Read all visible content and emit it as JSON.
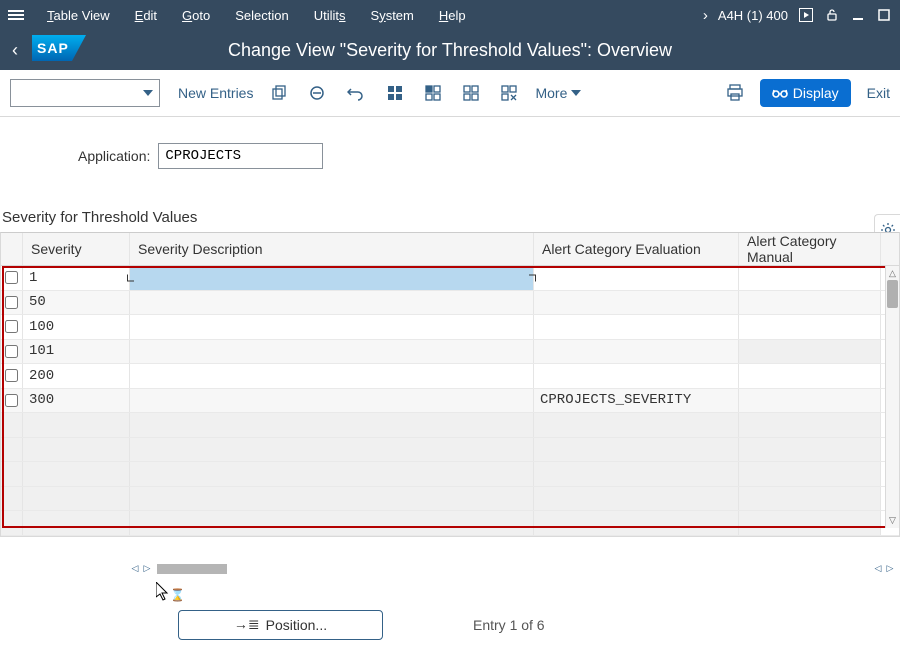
{
  "menubar": {
    "items": [
      "Table View",
      "Edit",
      "Goto",
      "Selection",
      "Utilities",
      "System",
      "Help"
    ],
    "system_id": "A4H (1) 400"
  },
  "titlebar": {
    "logo": "SAP",
    "title": "Change View \"Severity for Threshold Values\": Overview"
  },
  "toolbar": {
    "new_entries": "New Entries",
    "more": "More",
    "display": "Display",
    "exit": "Exit"
  },
  "application": {
    "label": "Application:",
    "value": "CPROJECTS"
  },
  "section_title": "Severity for Threshold Values",
  "columns": {
    "sev": "Severity",
    "desc": "Severity Description",
    "alert1": "Alert Category Evaluation",
    "alert2": "Alert Category Manual"
  },
  "rows": [
    {
      "severity": "1",
      "desc": "",
      "alert1": "",
      "alert2": "",
      "selected": true,
      "alert2_grey": false
    },
    {
      "severity": "50",
      "desc": "",
      "alert1": "",
      "alert2": "",
      "selected": false,
      "alert2_grey": false
    },
    {
      "severity": "100",
      "desc": "",
      "alert1": "",
      "alert2": "",
      "selected": false,
      "alert2_grey": false
    },
    {
      "severity": "101",
      "desc": "",
      "alert1": "",
      "alert2": "",
      "selected": false,
      "alert2_grey": true
    },
    {
      "severity": "200",
      "desc": "",
      "alert1": "",
      "alert2": "",
      "selected": false,
      "alert2_grey": false
    },
    {
      "severity": "300",
      "desc": "",
      "alert1": "CPROJECTS_SEVERITY",
      "alert2": "",
      "selected": false,
      "alert2_grey": false
    }
  ],
  "empty_rows": 5,
  "footer": {
    "position_btn": "Position...",
    "entry_text": "Entry 1 of 6"
  }
}
